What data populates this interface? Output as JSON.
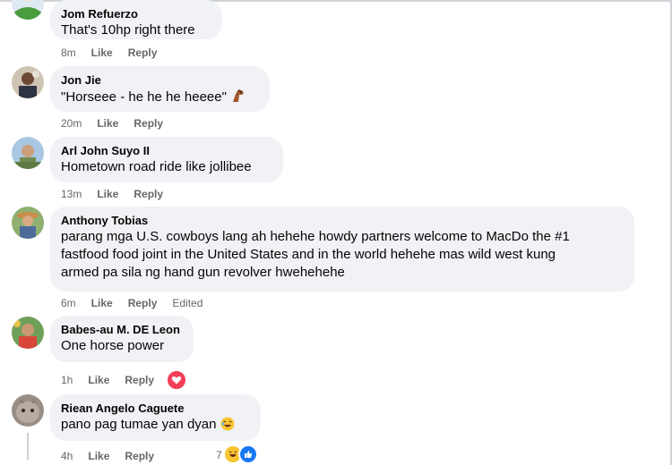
{
  "comments": [
    {
      "author": "Jom Refuerzo",
      "text": "That's 10hp right there",
      "time": "8m",
      "like": "Like",
      "reply": "Reply"
    },
    {
      "author": "Jon Jie",
      "text": "\"Horseee - he he he heeee\"",
      "time": "20m",
      "like": "Like",
      "reply": "Reply",
      "emoji": "horse-emoji"
    },
    {
      "author": "Arl John Suyo II",
      "text": "Hometown road ride like jollibee",
      "time": "13m",
      "like": "Like",
      "reply": "Reply"
    },
    {
      "author": "Anthony Tobias",
      "text_lines": [
        "parang mga U.S. cowboys lang ah hehehe howdy partners welcome to MacDo the #1",
        "fastfood food joint in the United States and in the world hehehe mas wild west kung",
        "armed pa sila ng hand gun revolver hwehehehe"
      ],
      "time": "6m",
      "like": "Like",
      "reply": "Reply",
      "edited": "Edited"
    },
    {
      "author": "Babes-au M. DE Leon",
      "text": "One horse power",
      "time": "1h",
      "like": "Like",
      "reply": "Reply",
      "reaction": "heart"
    },
    {
      "author": "Riean Angelo Caguete",
      "text": "pano pag tumae yan dyan",
      "time": "4h",
      "like": "Like",
      "reply": "Reply",
      "emoji": "laughing-emoji",
      "reaction_count": "7",
      "reactions": [
        "haha",
        "like"
      ]
    }
  ],
  "colors": {
    "bubble": "#f0f2f5",
    "meta": "#65676b",
    "heart": "#f33e58",
    "like_blue": "#1877f2"
  }
}
